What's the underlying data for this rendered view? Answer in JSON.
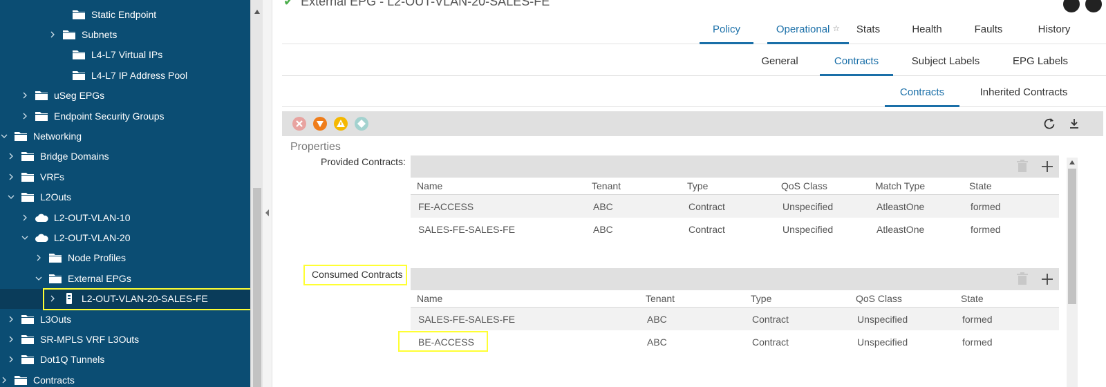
{
  "sidebar": {
    "items": [
      {
        "label": "Static Endpoint",
        "icon": "folder-icon",
        "chevron": "none"
      },
      {
        "label": "Subnets",
        "icon": "folder-icon",
        "chevron": "right"
      },
      {
        "label": "L4-L7 Virtual IPs",
        "icon": "folder-icon",
        "chevron": "none"
      },
      {
        "label": "L4-L7 IP Address Pool",
        "icon": "folder-icon",
        "chevron": "none"
      },
      {
        "label": "uSeg EPGs",
        "icon": "folder-icon",
        "chevron": "right"
      },
      {
        "label": "Endpoint Security Groups",
        "icon": "folder-icon",
        "chevron": "right"
      },
      {
        "label": "Networking",
        "icon": "folder-icon",
        "chevron": "down"
      },
      {
        "label": "Bridge Domains",
        "icon": "folder-icon",
        "chevron": "right"
      },
      {
        "label": "VRFs",
        "icon": "folder-icon",
        "chevron": "right"
      },
      {
        "label": "L2Outs",
        "icon": "folder-icon",
        "chevron": "down"
      },
      {
        "label": "L2-OUT-VLAN-10",
        "icon": "cloud-icon",
        "chevron": "right"
      },
      {
        "label": "L2-OUT-VLAN-20",
        "icon": "cloud-icon",
        "chevron": "down"
      },
      {
        "label": "Node Profiles",
        "icon": "folder-icon",
        "chevron": "right"
      },
      {
        "label": "External EPGs",
        "icon": "folder-icon",
        "chevron": "down"
      },
      {
        "label": "L2-OUT-VLAN-20-SALES-FE",
        "icon": "epg-icon",
        "chevron": "right"
      },
      {
        "label": "L3Outs",
        "icon": "folder-icon",
        "chevron": "right"
      },
      {
        "label": "SR-MPLS VRF L3Outs",
        "icon": "folder-icon",
        "chevron": "right"
      },
      {
        "label": "Dot1Q Tunnels",
        "icon": "folder-icon",
        "chevron": "right"
      },
      {
        "label": "Contracts",
        "icon": "folder-icon",
        "chevron": "right"
      }
    ]
  },
  "header": {
    "title": "External EPG - L2-OUT-VLAN-20-SALES-FE"
  },
  "tabs_primary": [
    {
      "label": "Policy",
      "active": true
    },
    {
      "label": "Operational",
      "active": true,
      "star": "☆"
    },
    {
      "label": "Stats",
      "active": false
    },
    {
      "label": "Health",
      "active": false
    },
    {
      "label": "Faults",
      "active": false
    },
    {
      "label": "History",
      "active": false
    }
  ],
  "tabs_secondary": [
    {
      "label": "General",
      "active": false
    },
    {
      "label": "Contracts",
      "active": true
    },
    {
      "label": "Subject Labels",
      "active": false
    },
    {
      "label": "EPG Labels",
      "active": false
    }
  ],
  "tabs_tertiary": [
    {
      "label": "Contracts",
      "active": true
    },
    {
      "label": "Inherited Contracts",
      "active": false
    }
  ],
  "properties_label": "Properties",
  "provided": {
    "label": "Provided Contracts:",
    "columns": [
      "Name",
      "Tenant",
      "Type",
      "QoS Class",
      "Match Type",
      "State"
    ],
    "rows": [
      [
        "FE-ACCESS",
        "ABC",
        "Contract",
        "Unspecified",
        "AtleastOne",
        "formed"
      ],
      [
        "SALES-FE-SALES-FE",
        "ABC",
        "Contract",
        "Unspecified",
        "AtleastOne",
        "formed"
      ]
    ]
  },
  "consumed": {
    "label": "Consumed Contracts",
    "columns": [
      "Name",
      "Tenant",
      "Type",
      "QoS Class",
      "State"
    ],
    "rows": [
      [
        "SALES-FE-SALES-FE",
        "ABC",
        "Contract",
        "Unspecified",
        "formed"
      ],
      [
        "BE-ACCESS",
        "ABC",
        "Contract",
        "Unspecified",
        "formed"
      ]
    ]
  },
  "colors": {
    "sidebar_bg": "#0b4d73",
    "accent": "#1a6fa8",
    "highlight": "#ffff33"
  }
}
